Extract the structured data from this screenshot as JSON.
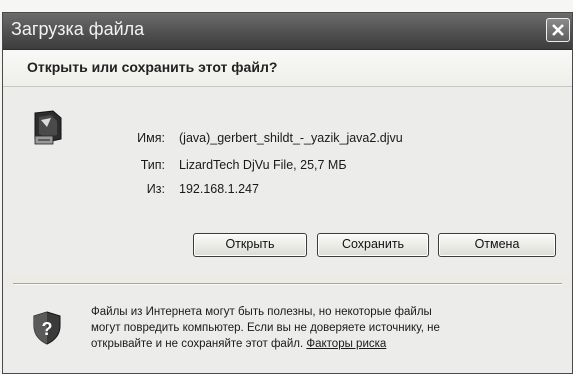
{
  "window": {
    "title": "Загрузка файла",
    "question": "Открыть или сохранить этот файл?"
  },
  "file": {
    "name_label": "Имя:",
    "name_value": "(java)_gerbert_shildt_-_yazik_java2.djvu",
    "type_label": "Тип:",
    "type_value": "LizardTech DjVu File, 25,7 МБ",
    "from_label": "Из:",
    "from_value": "192.168.1.247",
    "icon": "djvu-file-icon"
  },
  "buttons": {
    "open": "Открыть",
    "save": "Сохранить",
    "cancel": "Отмена"
  },
  "warning": {
    "icon": "shield-question-icon",
    "line1": "Файлы из Интернета могут быть полезны, но некоторые файлы",
    "line2": "могут повредить компьютер. Если вы не доверяете источнику, не",
    "line3": "открывайте и не сохраняйте этот файл.",
    "link": "Факторы риска"
  }
}
